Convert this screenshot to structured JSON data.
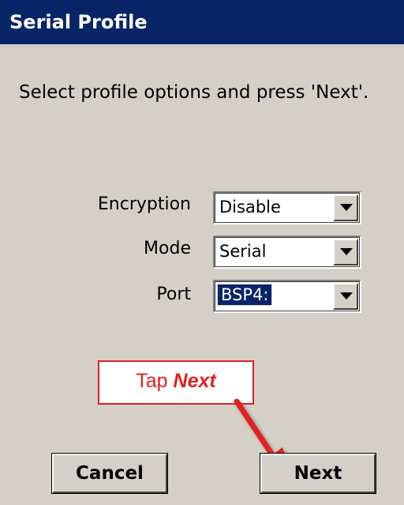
{
  "window": {
    "title": "Serial Profile"
  },
  "instruction": "Select profile options and press 'Next'.",
  "fields": [
    {
      "label": "Encryption",
      "value": "Disable"
    },
    {
      "label": "Mode",
      "value": "Serial"
    },
    {
      "label": "Port",
      "value": "BSP4:"
    }
  ],
  "callout": {
    "prefix": "Tap ",
    "emphasis": "Next"
  },
  "buttons": {
    "cancel": "Cancel",
    "next": "Next"
  },
  "colors": {
    "titlebar": "#0a2468",
    "dialog_bg": "#d4d0c8",
    "callout_red": "#e02020",
    "selection": "#0a246a"
  },
  "icons": {
    "dropdown": "chevron-down-icon",
    "pointer": "red-arrow-icon"
  }
}
